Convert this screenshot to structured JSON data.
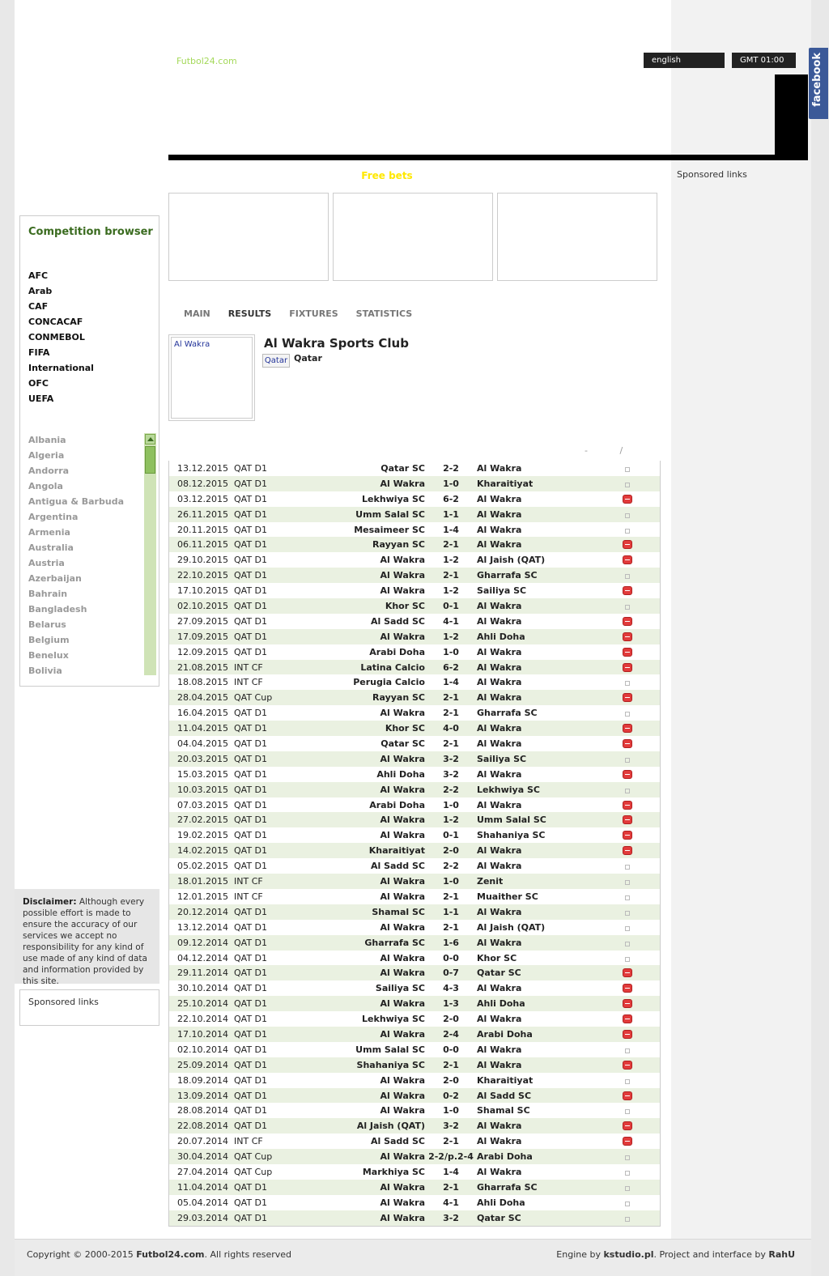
{
  "header": {
    "logo": "Futbol24.com",
    "language": "english",
    "timezone": "GMT 01:00",
    "facebook": "facebook",
    "free_bets": "Free bets",
    "sponsored": "Sponsored links"
  },
  "tabs": [
    "MAIN",
    "RESULTS",
    "FIXTURES",
    "STATISTICS"
  ],
  "team": {
    "image_alt": "Al Wakra",
    "name": "Al Wakra Sports Club",
    "flag_label": "Qatar",
    "country": "Qatar"
  },
  "results_nav": "- /",
  "results": [
    [
      "13.12.2015",
      "QAT D1",
      "Qatar SC",
      "2-2",
      "Al Wakra",
      "s"
    ],
    [
      "08.12.2015",
      "QAT D1",
      "Al Wakra",
      "1-0",
      "Kharaitiyat",
      "s"
    ],
    [
      "03.12.2015",
      "QAT D1",
      "Lekhwiya SC",
      "6-2",
      "Al Wakra",
      "r"
    ],
    [
      "26.11.2015",
      "QAT D1",
      "Umm Salal SC",
      "1-1",
      "Al Wakra",
      "s"
    ],
    [
      "20.11.2015",
      "QAT D1",
      "Mesaimeer SC",
      "1-4",
      "Al Wakra",
      "s"
    ],
    [
      "06.11.2015",
      "QAT D1",
      "Rayyan SC",
      "2-1",
      "Al Wakra",
      "r"
    ],
    [
      "29.10.2015",
      "QAT D1",
      "Al Wakra",
      "1-2",
      "Al Jaish (QAT)",
      "r"
    ],
    [
      "22.10.2015",
      "QAT D1",
      "Al Wakra",
      "2-1",
      "Gharrafa SC",
      "s"
    ],
    [
      "17.10.2015",
      "QAT D1",
      "Al Wakra",
      "1-2",
      "Sailiya SC",
      "r"
    ],
    [
      "02.10.2015",
      "QAT D1",
      "Khor SC",
      "0-1",
      "Al Wakra",
      "s"
    ],
    [
      "27.09.2015",
      "QAT D1",
      "Al Sadd SC",
      "4-1",
      "Al Wakra",
      "r"
    ],
    [
      "17.09.2015",
      "QAT D1",
      "Al Wakra",
      "1-2",
      "Ahli Doha",
      "r"
    ],
    [
      "12.09.2015",
      "QAT D1",
      "Arabi Doha",
      "1-0",
      "Al Wakra",
      "r"
    ],
    [
      "21.08.2015",
      "INT CF",
      "Latina Calcio",
      "6-2",
      "Al Wakra",
      "r"
    ],
    [
      "18.08.2015",
      "INT CF",
      "Perugia Calcio",
      "1-4",
      "Al Wakra",
      "s"
    ],
    [
      "28.04.2015",
      "QAT Cup",
      "Rayyan SC",
      "2-1",
      "Al Wakra",
      "r"
    ],
    [
      "16.04.2015",
      "QAT D1",
      "Al Wakra",
      "2-1",
      "Gharrafa SC",
      "s"
    ],
    [
      "11.04.2015",
      "QAT D1",
      "Khor SC",
      "4-0",
      "Al Wakra",
      "r"
    ],
    [
      "04.04.2015",
      "QAT D1",
      "Qatar SC",
      "2-1",
      "Al Wakra",
      "r"
    ],
    [
      "20.03.2015",
      "QAT D1",
      "Al Wakra",
      "3-2",
      "Sailiya SC",
      "s"
    ],
    [
      "15.03.2015",
      "QAT D1",
      "Ahli Doha",
      "3-2",
      "Al Wakra",
      "r"
    ],
    [
      "10.03.2015",
      "QAT D1",
      "Al Wakra",
      "2-2",
      "Lekhwiya SC",
      "s"
    ],
    [
      "07.03.2015",
      "QAT D1",
      "Arabi Doha",
      "1-0",
      "Al Wakra",
      "r"
    ],
    [
      "27.02.2015",
      "QAT D1",
      "Al Wakra",
      "1-2",
      "Umm Salal SC",
      "r"
    ],
    [
      "19.02.2015",
      "QAT D1",
      "Al Wakra",
      "0-1",
      "Shahaniya SC",
      "r"
    ],
    [
      "14.02.2015",
      "QAT D1",
      "Kharaitiyat",
      "2-0",
      "Al Wakra",
      "r"
    ],
    [
      "05.02.2015",
      "QAT D1",
      "Al Sadd SC",
      "2-2",
      "Al Wakra",
      "s"
    ],
    [
      "18.01.2015",
      "INT CF",
      "Al Wakra",
      "1-0",
      "Zenit",
      "s"
    ],
    [
      "12.01.2015",
      "INT CF",
      "Al Wakra",
      "2-1",
      "Muaither SC",
      "s"
    ],
    [
      "20.12.2014",
      "QAT D1",
      "Shamal SC",
      "1-1",
      "Al Wakra",
      "s"
    ],
    [
      "13.12.2014",
      "QAT D1",
      "Al Wakra",
      "2-1",
      "Al Jaish (QAT)",
      "s"
    ],
    [
      "09.12.2014",
      "QAT D1",
      "Gharrafa SC",
      "1-6",
      "Al Wakra",
      "s"
    ],
    [
      "04.12.2014",
      "QAT D1",
      "Al Wakra",
      "0-0",
      "Khor SC",
      "s"
    ],
    [
      "29.11.2014",
      "QAT D1",
      "Al Wakra",
      "0-7",
      "Qatar SC",
      "r"
    ],
    [
      "30.10.2014",
      "QAT D1",
      "Sailiya SC",
      "4-3",
      "Al Wakra",
      "r"
    ],
    [
      "25.10.2014",
      "QAT D1",
      "Al Wakra",
      "1-3",
      "Ahli Doha",
      "r"
    ],
    [
      "22.10.2014",
      "QAT D1",
      "Lekhwiya SC",
      "2-0",
      "Al Wakra",
      "r"
    ],
    [
      "17.10.2014",
      "QAT D1",
      "Al Wakra",
      "2-4",
      "Arabi Doha",
      "r"
    ],
    [
      "02.10.2014",
      "QAT D1",
      "Umm Salal SC",
      "0-0",
      "Al Wakra",
      "s"
    ],
    [
      "25.09.2014",
      "QAT D1",
      "Shahaniya SC",
      "2-1",
      "Al Wakra",
      "r"
    ],
    [
      "18.09.2014",
      "QAT D1",
      "Al Wakra",
      "2-0",
      "Kharaitiyat",
      "s"
    ],
    [
      "13.09.2014",
      "QAT D1",
      "Al Wakra",
      "0-2",
      "Al Sadd SC",
      "r"
    ],
    [
      "28.08.2014",
      "QAT D1",
      "Al Wakra",
      "1-0",
      "Shamal SC",
      "s"
    ],
    [
      "22.08.2014",
      "QAT D1",
      "Al Jaish (QAT)",
      "3-2",
      "Al Wakra",
      "r"
    ],
    [
      "20.07.2014",
      "INT CF",
      "Al Sadd SC",
      "2-1",
      "Al Wakra",
      "r"
    ],
    [
      "30.04.2014",
      "QAT Cup",
      "Al Wakra",
      "2-2/p.2-4",
      "Arabi Doha",
      "s"
    ],
    [
      "27.04.2014",
      "QAT Cup",
      "Markhiya SC",
      "1-4",
      "Al Wakra",
      "s"
    ],
    [
      "11.04.2014",
      "QAT D1",
      "Al Wakra",
      "2-1",
      "Gharrafa SC",
      "s"
    ],
    [
      "05.04.2014",
      "QAT D1",
      "Al Wakra",
      "4-1",
      "Ahli Doha",
      "s"
    ],
    [
      "29.03.2014",
      "QAT D1",
      "Al Wakra",
      "3-2",
      "Qatar SC",
      "s"
    ]
  ],
  "competition_browser": {
    "title": "Competition browser",
    "confederations": [
      "AFC",
      "Arab",
      "CAF",
      "CONCACAF",
      "CONMEBOL",
      "FIFA",
      "International",
      "OFC",
      "UEFA"
    ],
    "countries": [
      "Albania",
      "Algeria",
      "Andorra",
      "Angola",
      "Antigua & Barbuda",
      "Argentina",
      "Armenia",
      "Australia",
      "Austria",
      "Azerbaijan",
      "Bahrain",
      "Bangladesh",
      "Belarus",
      "Belgium",
      "Benelux",
      "Bolivia"
    ]
  },
  "disclaimer": {
    "label": "Disclaimer:",
    "text": " Although every possible effort is made to ensure the accuracy of our services we accept no responsibility for any kind of use made of any kind of data and information provided by this site."
  },
  "sponsored_left": "Sponsored links",
  "footer": {
    "copyright_pre": "Copyright © 2000-2015 ",
    "copyright_site": "Futbol24.com",
    "copyright_post": ". All rights reserved",
    "engine_pre": "Engine by ",
    "engine_name": "kstudio.pl",
    "engine_mid": ". Project and interface by ",
    "engine_author": "RahU"
  },
  "colors": {
    "accent_green": "#3a6b1f",
    "row_alt": "#eaf1e1",
    "free_bets": "#ffe800",
    "loss_icon": "#e23b3b"
  }
}
